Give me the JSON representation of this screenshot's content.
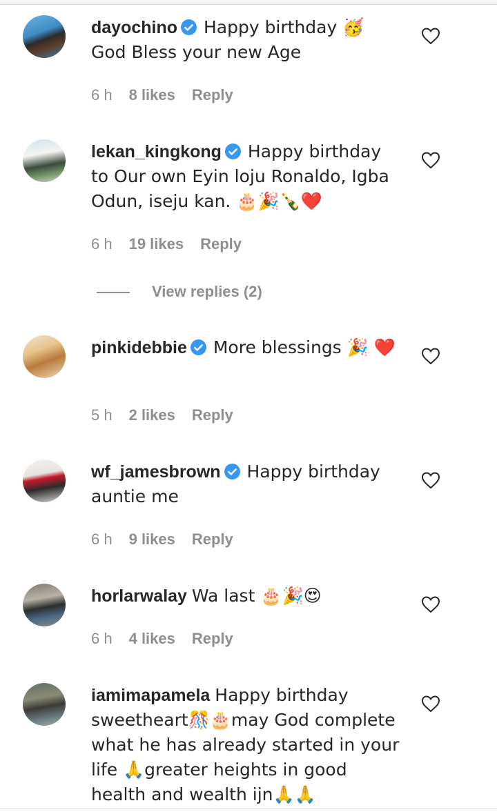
{
  "comments": [
    {
      "username": "dayochino",
      "verified": true,
      "text": "Happy birthday 🥳 God Bless your new Age",
      "time": "6 h",
      "likes": "8 likes",
      "reply": "Reply"
    },
    {
      "username": "lekan_kingkong",
      "verified": true,
      "text": "Happy birthday to Our own Eyin loju Ronaldo, Igba Odun, iseju kan. 🎂🎉🍾❤️",
      "time": "6 h",
      "likes": "19 likes",
      "reply": "Reply",
      "view_replies": "View replies (2)"
    },
    {
      "username": "pinkidebbie",
      "verified": true,
      "text": "More blessings 🎉 ❤️",
      "time": "5 h",
      "likes": "2 likes",
      "reply": "Reply"
    },
    {
      "username": "wf_jamesbrown",
      "verified": true,
      "text": "Happy birthday auntie me",
      "time": "6 h",
      "likes": "9 likes",
      "reply": "Reply"
    },
    {
      "username": "horlarwalay",
      "verified": false,
      "text": "Wa last 🎂🎉😍",
      "time": "6 h",
      "likes": "4 likes",
      "reply": "Reply"
    },
    {
      "username": "iamimapamela",
      "verified": false,
      "text": "Happy birthday sweetheart🎊🎂may God complete what he has already started in your life 🙏greater heights in good health and wealth ijn🙏🙏"
    }
  ],
  "icons": {
    "verified": "verified-badge-icon",
    "like": "heart-outline-icon"
  },
  "colors": {
    "verified": "#3897f0",
    "meta": "#8e8e8e",
    "text": "#262626"
  }
}
